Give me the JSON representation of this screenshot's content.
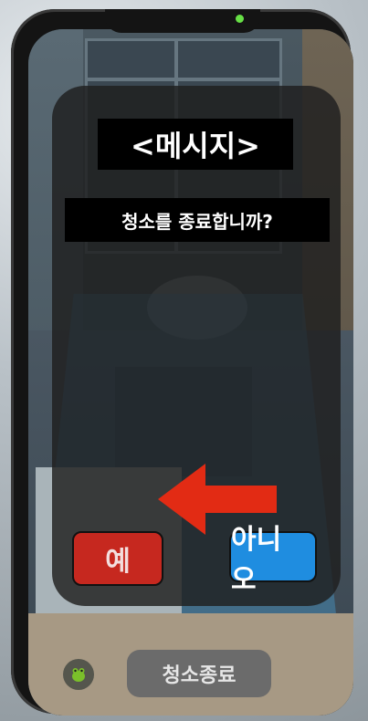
{
  "dialog": {
    "title": "<메시지>",
    "message": "청소를 종료합니까?",
    "yes_label": "예",
    "no_label": "아니오"
  },
  "toolbar": {
    "end_cleaning_label": "청소종료",
    "avatar_icon": "frog-icon"
  },
  "colors": {
    "yes": "#c6281f",
    "no": "#1f8de0",
    "arrow": "#e22b14",
    "status_dot": "#67e046"
  }
}
